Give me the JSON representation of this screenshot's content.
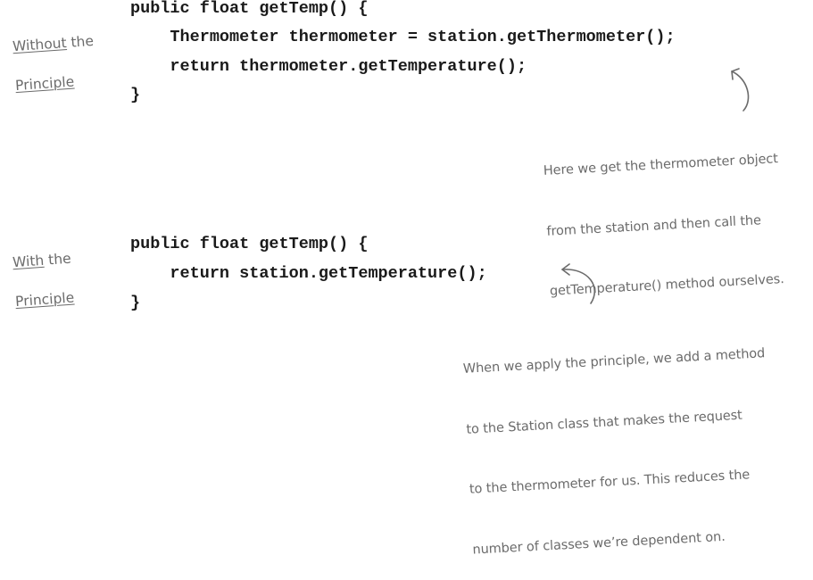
{
  "without_section": {
    "label_line1_underlined": "Without",
    "label_line1_rest": " the",
    "label_line2": "Principle",
    "code_lines": [
      "public float getTemp() {",
      "    Thermometer thermometer = station.getThermometer();",
      "    return thermometer.getTemperature();",
      "}"
    ],
    "note_lines": [
      "Here we get the thermometer object",
      "from the station and then call the",
      "getTemperature() method ourselves."
    ]
  },
  "with_section": {
    "label_line1_underlined": "With",
    "label_line1_rest": " the",
    "label_line2": "Principle",
    "code_lines": [
      "public float getTemp() {",
      "    return station.getTemperature();",
      "}"
    ],
    "note_lines": [
      "When we apply the principle, we add a method",
      "to the Station class that makes the request",
      "to the thermometer for us. This reduces the",
      "number of classes we’re dependent on."
    ]
  },
  "colors": {
    "code": "#1a1a1a",
    "handwriting": "#6b6b6b",
    "background": "#ffffff"
  }
}
